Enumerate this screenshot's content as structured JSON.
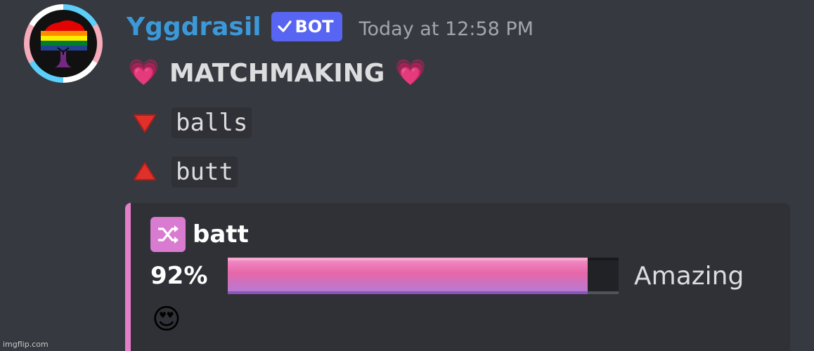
{
  "message": {
    "author": "Yggdrasil",
    "bot_tag": "BOT",
    "timestamp": "Today at 12:58 PM",
    "title": {
      "emoji_left": "💗",
      "text": "MATCHMAKING",
      "emoji_right": "💗"
    },
    "lines": [
      {
        "indicator": "down",
        "text": "balls"
      },
      {
        "indicator": "up",
        "text": "butt"
      }
    ]
  },
  "embed": {
    "accent_color": "#e47ec9",
    "icon": "shuffle-icon",
    "name": "batt",
    "percent_text": "92%",
    "percent_value": 0.92,
    "rating": "Amazing",
    "emoji": "😍"
  },
  "colors": {
    "background": "#36393f",
    "username": "#3b99d9",
    "bot_tag": "#5865f2"
  },
  "watermark": "imgflip.com"
}
